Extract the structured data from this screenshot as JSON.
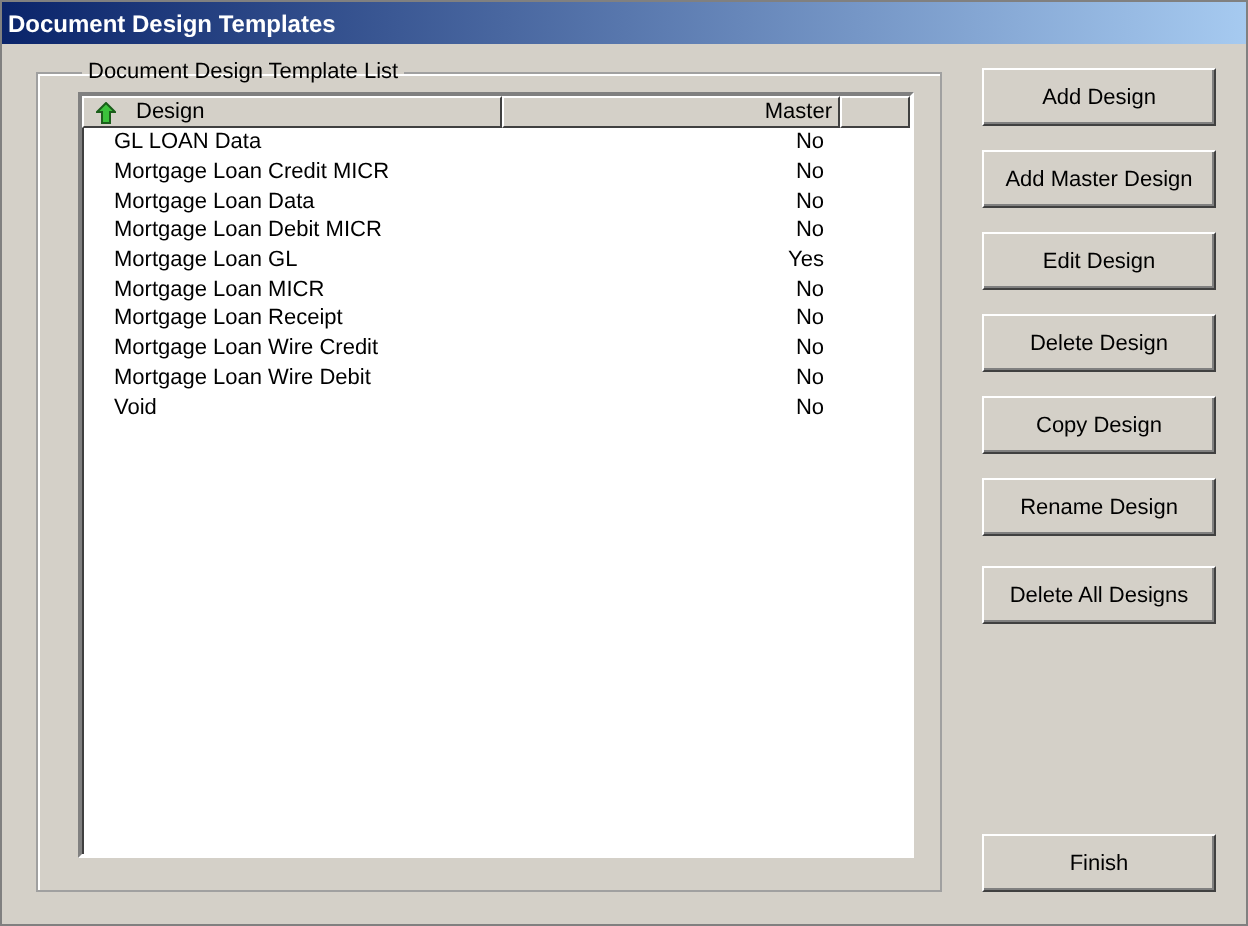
{
  "window": {
    "title": "Document Design Templates"
  },
  "group": {
    "title": "Document Design Template List"
  },
  "table": {
    "columns": [
      {
        "label": "Design",
        "sorted": true
      },
      {
        "label": "Master",
        "sorted": false
      }
    ],
    "rows": [
      {
        "design": "GL LOAN Data",
        "master": "No"
      },
      {
        "design": "Mortgage Loan Credit MICR",
        "master": "No"
      },
      {
        "design": "Mortgage Loan Data",
        "master": "No"
      },
      {
        "design": "Mortgage Loan Debit MICR",
        "master": "No"
      },
      {
        "design": "Mortgage Loan GL",
        "master": "Yes"
      },
      {
        "design": "Mortgage Loan MICR",
        "master": "No"
      },
      {
        "design": "Mortgage Loan Receipt",
        "master": "No"
      },
      {
        "design": "Mortgage Loan Wire Credit",
        "master": "No"
      },
      {
        "design": "Mortgage Loan Wire Debit",
        "master": "No"
      },
      {
        "design": "Void",
        "master": "No"
      }
    ]
  },
  "buttons": [
    "Add Design",
    "Add Master Design",
    "Edit Design",
    "Delete Design",
    "Copy Design",
    "Rename Design",
    "Delete All Designs"
  ],
  "finish_button": "Finish"
}
